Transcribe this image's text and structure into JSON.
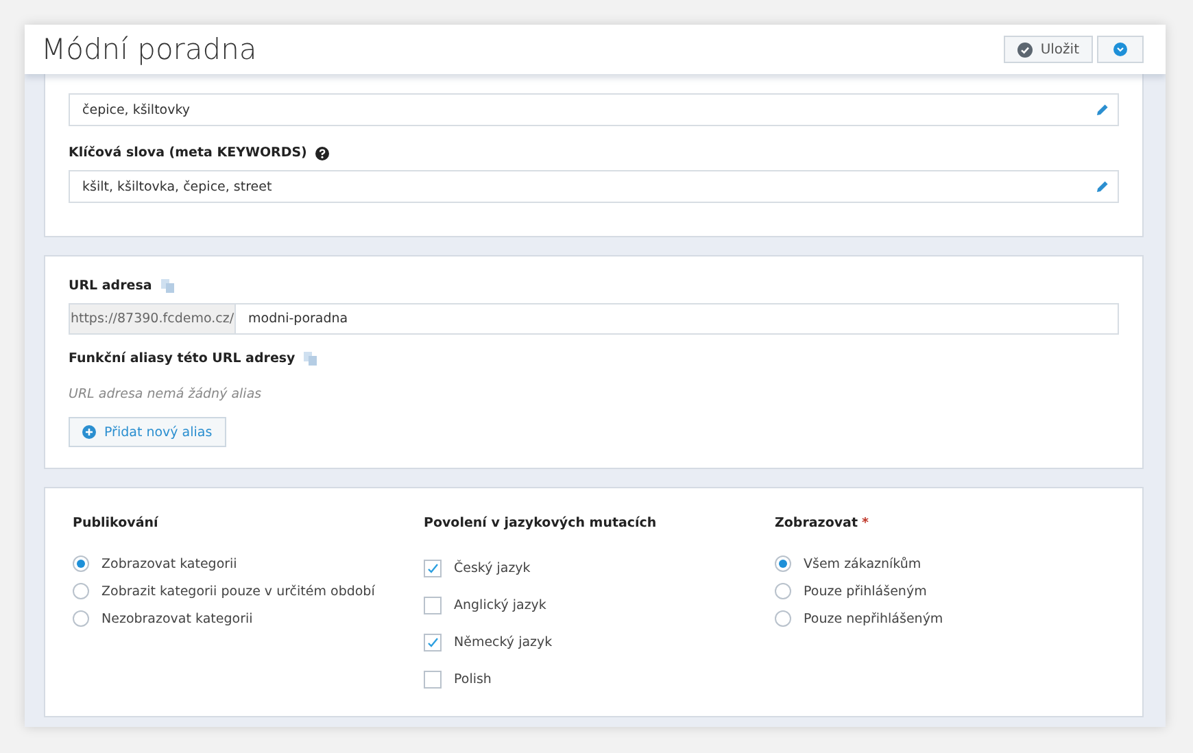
{
  "header": {
    "title": "Módní poradna",
    "save_button": "Uložit"
  },
  "meta": {
    "description_value": "čepice, kšiltovky",
    "keywords_label": "Klíčová slova (meta KEYWORDS)",
    "keywords_value": "kšilt, kšiltovka, čepice, street"
  },
  "url": {
    "label": "URL adresa",
    "prefix": "https://87390.fcdemo.cz/",
    "value": "modni-poradna",
    "aliases_label": "Funkční aliasy této URL adresy",
    "no_alias": "URL adresa nemá žádný alias",
    "add_button": "Přidat nový alias"
  },
  "columns": [
    {
      "kind": "radio",
      "heading": "Publikování",
      "options": [
        {
          "label": "Zobrazovat kategorii",
          "selected": true
        },
        {
          "label": "Zobrazit kategorii pouze v určitém období",
          "selected": false
        },
        {
          "label": "Nezobrazovat kategorii",
          "selected": false
        }
      ]
    },
    {
      "kind": "checkbox",
      "heading": "Povolení v jazykových mutacích",
      "options": [
        {
          "label": "Český jazyk",
          "checked": true
        },
        {
          "label": "Anglický jazyk",
          "checked": false
        },
        {
          "label": "Německý jazyk",
          "checked": true
        },
        {
          "label": "Polish",
          "checked": false
        }
      ]
    },
    {
      "kind": "radio",
      "heading": "Zobrazovat",
      "required_mark": "*",
      "options": [
        {
          "label": "Všem zákazníkům",
          "selected": true
        },
        {
          "label": "Pouze přihlášeným",
          "selected": false
        },
        {
          "label": "Pouze nepřihlášeným",
          "selected": false
        }
      ]
    }
  ]
}
